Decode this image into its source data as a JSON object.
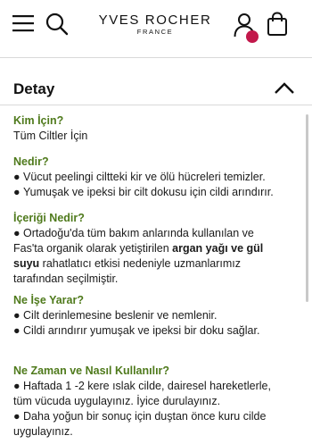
{
  "brand": {
    "name": "YVES ROCHER",
    "sub": "FRANCE"
  },
  "colors": {
    "accent": "#4f7a1c",
    "badge": "#c2184b"
  },
  "icons": {
    "menu": "menu-icon",
    "search": "search-icon",
    "user": "user-icon",
    "bag": "shopping-bag-icon"
  },
  "detail": {
    "title": "Detay"
  },
  "sections": {
    "kim": {
      "title": "Kim İçin?",
      "text": "Tüm Ciltler İçin"
    },
    "nedir": {
      "title": "Nedir?",
      "b1": "Vücut peelingi ciltteki kir ve ölü hücreleri temizler.",
      "b2": "Yumuşak ve ipeksi bir cilt dokusu için cildi arındırır."
    },
    "icerik": {
      "title": "İçeriği Nedir?",
      "p1": "Ortadoğu'da tüm bakım anlarında kullanılan ve",
      "p2a": "Fas'ta organik olarak yetiştirilen ",
      "p2b": "argan yağı ve gül",
      "p3a": "suyu",
      "p3b": " rahatlatıcı etkisi nedeniyle uzmanlarımız",
      "p4": "tarafından seçilmiştir."
    },
    "ne_ise": {
      "title": "Ne İşe Yarar?",
      "b1": "Cilt derinlemesine beslenir ve nemlenir.",
      "b2": "Cildi arındırır yumuşak ve ipeksi bir doku sağlar."
    },
    "kullanim": {
      "title": "Ne Zaman ve Nasıl Kullanılır?",
      "b1l1": "Haftada 1 -2 kere ıslak cilde, dairesel hareketlerle,",
      "b1l2": "tüm vücuda uygulayınız. İyice durulayınız.",
      "b2l1": "Daha yoğun bir sonuç için duştan önce kuru cilde",
      "b2l2": "uygulayınız."
    }
  }
}
